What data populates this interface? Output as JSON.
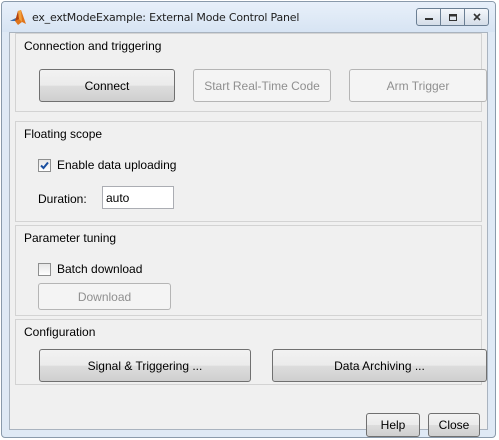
{
  "window": {
    "title": "ex_extModeExample: External Mode Control Panel",
    "icon": "matlab-logo-icon",
    "controls": [
      "minimize-icon",
      "maximize-icon",
      "close-icon"
    ]
  },
  "connection": {
    "title": "Connection and triggering",
    "connect_label": "Connect",
    "start_label": "Start Real-Time Code",
    "arm_label": "Arm Trigger"
  },
  "scope": {
    "title": "Floating scope",
    "enable_label": "Enable data uploading",
    "enable_checked": true,
    "duration_label": "Duration:",
    "duration_value": "auto"
  },
  "tuning": {
    "title": "Parameter tuning",
    "batch_label": "Batch download",
    "batch_checked": false,
    "download_label": "Download"
  },
  "configuration": {
    "title": "Configuration",
    "signal_label": "Signal & Triggering ...",
    "archiving_label": "Data Archiving ..."
  },
  "footer": {
    "help_label": "Help",
    "close_label": "Close"
  }
}
